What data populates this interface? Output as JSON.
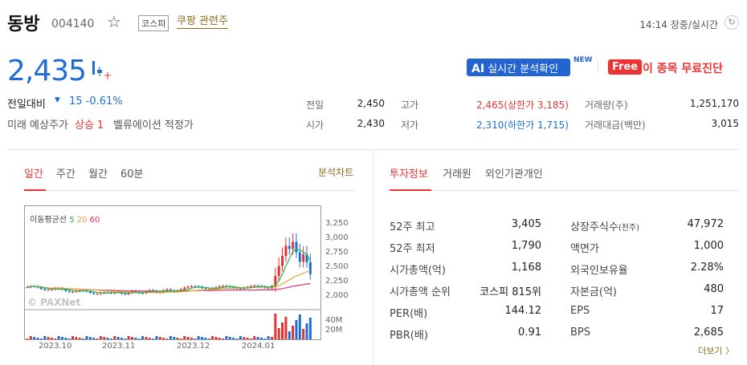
{
  "header": {
    "name": "동방",
    "code": "004140",
    "market": "코스피",
    "theme": "쿠팡 관련주",
    "time_status": "14:14 장중/실시간",
    "refresh_icon": "refresh-icon",
    "star_icon": "star-outline-icon"
  },
  "price": {
    "current": "2,435",
    "change_label": "전일대비",
    "change_value": "15 -0.61%",
    "future_label": "미래 예상주가",
    "future_value": "상승 1",
    "valuation_label": "벨류에이션 적정가"
  },
  "promo": {
    "ai_prefix": "AI",
    "ai_label": "실시간 분석확인",
    "new_tag": "NEW",
    "free_tag": "Free",
    "free_label": "이 종목 무료진단"
  },
  "quote": {
    "prev_label": "전일",
    "prev": "2,450",
    "open_label": "시가",
    "open": "2,430",
    "high_label": "고가",
    "high": "2,465(상한가 3,185)",
    "low_label": "저가",
    "low": "2,310(하한가 1,715)",
    "volume_label": "거래량(주)",
    "volume": "1,251,170",
    "amount_label": "거래대금(백만)",
    "amount": "3,015"
  },
  "chart_tabs": [
    "일간",
    "주간",
    "월간",
    "60분"
  ],
  "chart_link": "분석차트",
  "info_tabs": [
    "투자정보",
    "거래원",
    "외인기관개인"
  ],
  "chart": {
    "ma_title": "이동평균선",
    "ma5": "5",
    "ma20": "20",
    "ma60": "60",
    "watermark": "© PAXNet",
    "colors": {
      "up": "#e33333",
      "down": "#1e6ed6",
      "ma5": "#2bb24c",
      "ma20": "#e8a33a",
      "ma60": "#e3306a"
    }
  },
  "chart_data": {
    "type": "candlestick",
    "y_ticks": [
      "3,250",
      "3,000",
      "2,750",
      "2,500",
      "2,250",
      "2,000"
    ],
    "volume_ticks": [
      "40M",
      "20M"
    ],
    "x_ticks": [
      "2023.10",
      "2023.11",
      "2023.12",
      "2024.01"
    ],
    "ylim": [
      1800,
      3450
    ]
  },
  "info": {
    "left": [
      {
        "label": "52주 최고",
        "value": "3,405"
      },
      {
        "label": "52주 최저",
        "value": "1,790"
      },
      {
        "label": "시가총액(억)",
        "value": "1,168"
      },
      {
        "label": "시가총액 순위",
        "value": "코스피 815위"
      },
      {
        "label": "PER(배)",
        "value": "144.12"
      },
      {
        "label": "PBR(배)",
        "value": "0.91"
      }
    ],
    "right": [
      {
        "label": "상장주식수",
        "label_small": "(천주)",
        "value": "47,972"
      },
      {
        "label": "액면가",
        "label_small": "",
        "value": "1,000"
      },
      {
        "label": "외국인보유율",
        "label_small": "",
        "value": "2.28%"
      },
      {
        "label": "자본금(억)",
        "label_small": "",
        "value": "480"
      },
      {
        "label": "EPS",
        "label_small": "",
        "value": "17"
      },
      {
        "label": "BPS",
        "label_small": "",
        "value": "2,685"
      }
    ],
    "more": "더보기 〉"
  }
}
